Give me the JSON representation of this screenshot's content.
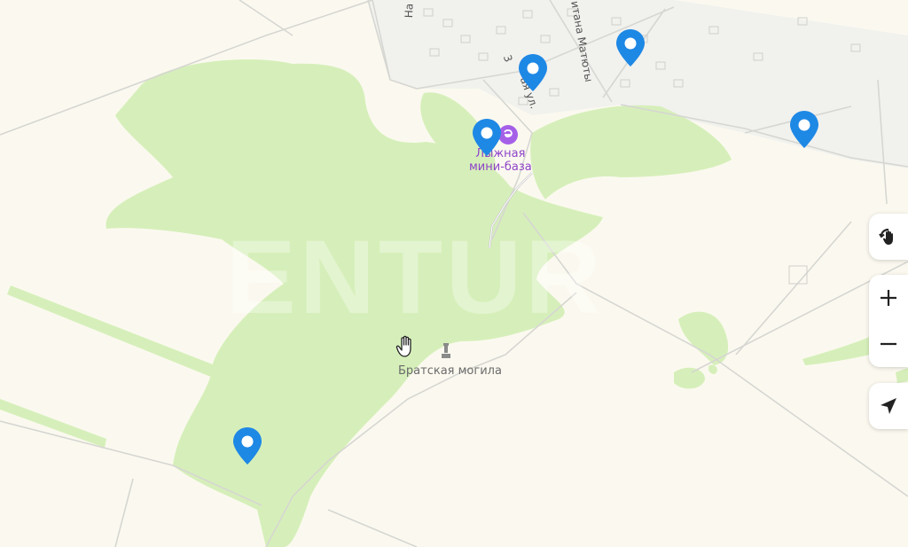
{
  "map": {
    "labels": {
      "ski_base": [
        "Лыжная",
        "мини-база"
      ],
      "grave": "Братская могила",
      "watermark": "ENTUR"
    },
    "streets": {
      "street1": "На",
      "street2": "ая ул.",
      "street2_prefix": "3",
      "street3": "итана Матюты"
    },
    "markers": [
      {
        "name": "map-marker-1"
      },
      {
        "name": "map-marker-2"
      },
      {
        "name": "map-marker-3"
      },
      {
        "name": "map-marker-4"
      },
      {
        "name": "map-marker-5"
      }
    ],
    "controls": {
      "rotate": "rotate-icon",
      "zoom_in": "plus-icon",
      "zoom_out": "minus-icon",
      "locate": "navigation-arrow-icon"
    },
    "colors": {
      "background": "#fbf9ef",
      "forest": "#d6efba",
      "road": "#cfcfcf",
      "marker": "#1e88e5",
      "poi": "#a560e8"
    }
  }
}
